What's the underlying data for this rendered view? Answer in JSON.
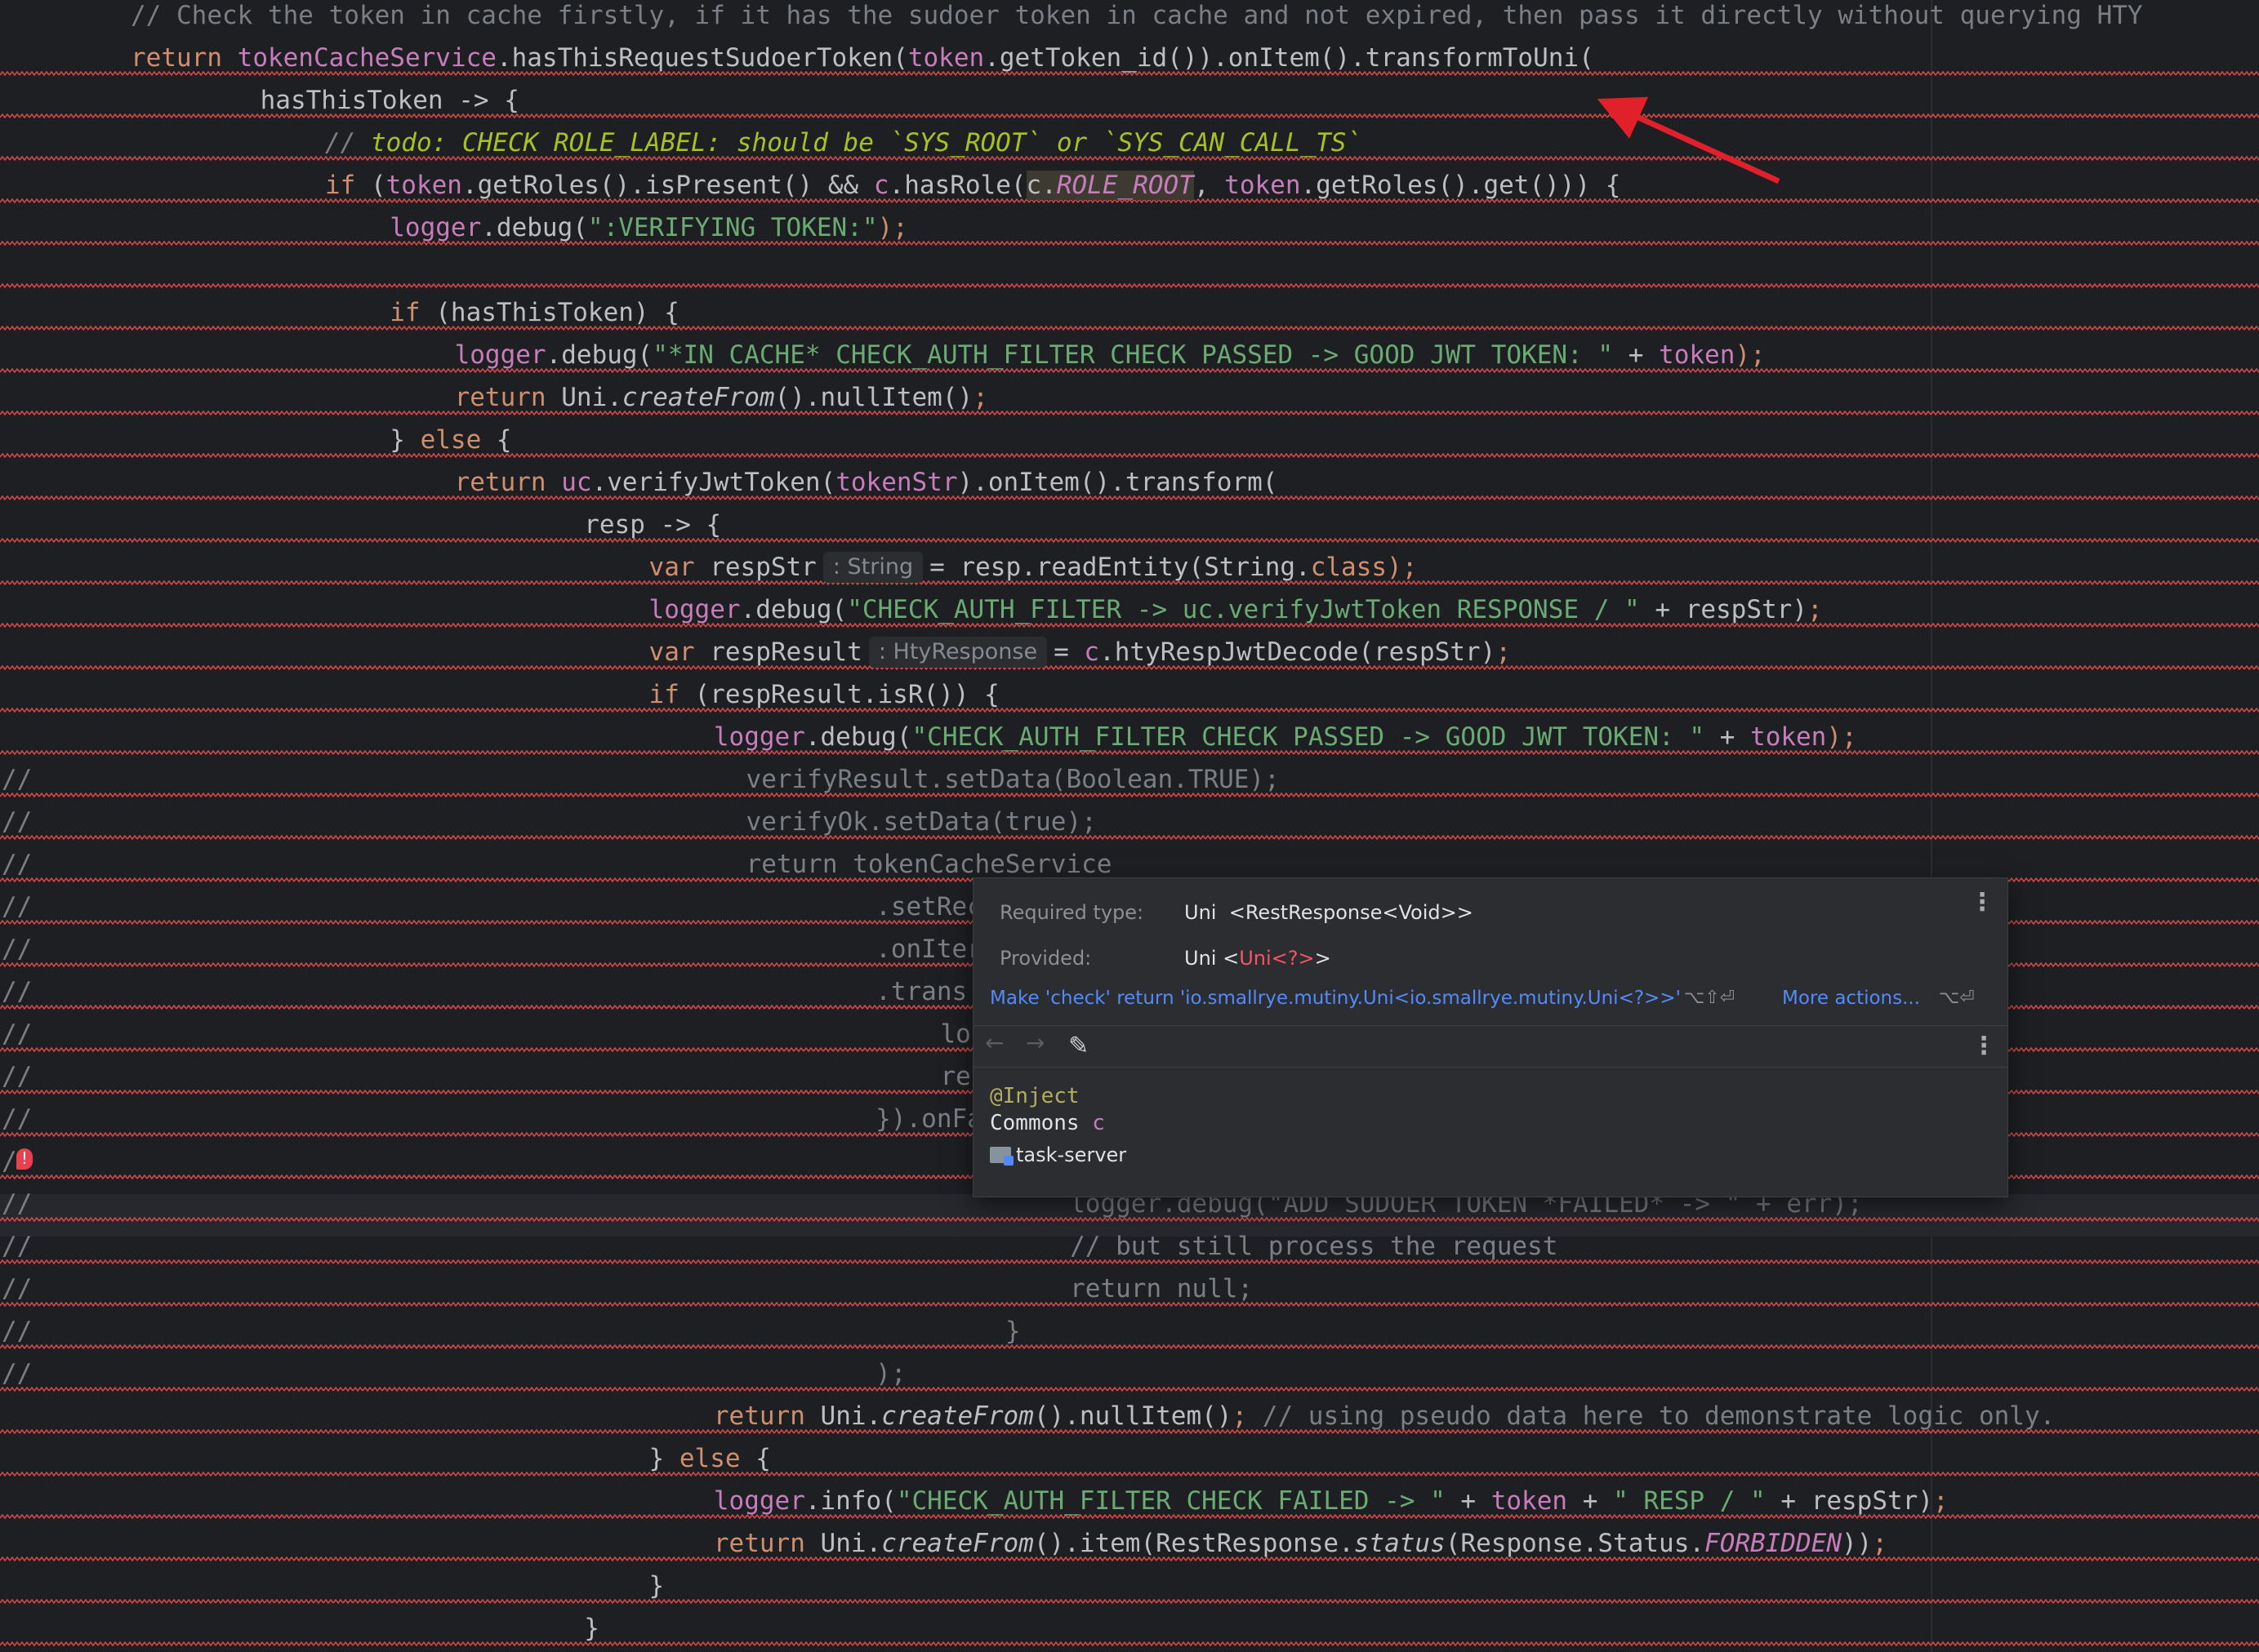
{
  "editor": {
    "lines": [
      {
        "gutter": "",
        "indent": 0,
        "tokens": [
          {
            "t": "// Check the token in cache firstly, if it has the sudoer token in cache and not expired, then pass it directly without querying HTY",
            "c": "cm"
          }
        ]
      },
      {
        "gutter": "",
        "indent": 0,
        "tokens": [
          {
            "t": "return ",
            "c": "kw"
          },
          {
            "t": "tokenCacheService",
            "c": "fld"
          },
          {
            "t": ".hasThisRequestSudoerToken(",
            "c": ""
          },
          {
            "t": "token",
            "c": "fld"
          },
          {
            "t": ".getToken_id()).onItem().transformToUni(",
            "c": ""
          }
        ]
      },
      {
        "gutter": "",
        "indent": 2,
        "tokens": [
          {
            "t": "hasThisToken -> {",
            "c": ""
          }
        ]
      },
      {
        "gutter": "",
        "indent": 3,
        "tokens": [
          {
            "t": "// ",
            "c": "cmi"
          },
          {
            "t": "todo: CHECK ROLE_LABEL: should be `SYS_ROOT` or `SYS_CAN_CALL_TS`",
            "c": "todo"
          }
        ]
      },
      {
        "gutter": "",
        "indent": 3,
        "tokens": [
          {
            "t": "if ",
            "c": "kw"
          },
          {
            "t": "(",
            "c": ""
          },
          {
            "t": "token",
            "c": "fld"
          },
          {
            "t": ".getRoles().isPresent() && ",
            "c": ""
          },
          {
            "t": "c",
            "c": "fld"
          },
          {
            "t": ".hasRole(",
            "c": ""
          },
          {
            "t": "c.",
            "c": "hl"
          },
          {
            "t": "ROLE_ROOT",
            "c": "cst hl"
          },
          {
            "t": ", ",
            "c": ""
          },
          {
            "t": "token",
            "c": "fld"
          },
          {
            "t": ".getRoles().get())) {",
            "c": ""
          }
        ]
      },
      {
        "gutter": "",
        "indent": 4,
        "tokens": [
          {
            "t": "logger",
            "c": "fld"
          },
          {
            "t": ".debug(",
            "c": ""
          },
          {
            "t": "\":VERIFYING TOKEN:\"",
            "c": "str"
          },
          {
            "t": ");",
            "c": "kw"
          }
        ]
      },
      {
        "gutter": "",
        "indent": 0,
        "tokens": []
      },
      {
        "gutter": "",
        "indent": 4,
        "tokens": [
          {
            "t": "if ",
            "c": "kw"
          },
          {
            "t": "(hasThisToken) {",
            "c": ""
          }
        ]
      },
      {
        "gutter": "",
        "indent": 5,
        "tokens": [
          {
            "t": "logger",
            "c": "fld"
          },
          {
            "t": ".debug(",
            "c": ""
          },
          {
            "t": "\"*IN CACHE* CHECK_AUTH_FILTER CHECK PASSED -> GOOD JWT TOKEN: \"",
            "c": "str"
          },
          {
            "t": " + ",
            "c": ""
          },
          {
            "t": "token",
            "c": "fld"
          },
          {
            "t": ");",
            "c": "kw"
          }
        ]
      },
      {
        "gutter": "",
        "indent": 5,
        "tokens": [
          {
            "t": "return ",
            "c": "kw"
          },
          {
            "t": "Uni.",
            "c": ""
          },
          {
            "t": "createFrom",
            "c": "it"
          },
          {
            "t": "().nullItem()",
            "c": ""
          },
          {
            "t": ";",
            "c": "kw"
          }
        ]
      },
      {
        "gutter": "",
        "indent": 4,
        "tokens": [
          {
            "t": "} ",
            "c": ""
          },
          {
            "t": "else ",
            "c": "kw"
          },
          {
            "t": "{",
            "c": ""
          }
        ]
      },
      {
        "gutter": "",
        "indent": 5,
        "tokens": [
          {
            "t": "return ",
            "c": "kw"
          },
          {
            "t": "uc",
            "c": "fld"
          },
          {
            "t": ".verifyJwtToken(",
            "c": ""
          },
          {
            "t": "tokenStr",
            "c": "fld"
          },
          {
            "t": ").onItem().transform(",
            "c": ""
          }
        ]
      },
      {
        "gutter": "",
        "indent": 7,
        "tokens": [
          {
            "t": "resp -> {",
            "c": ""
          }
        ]
      },
      {
        "gutter": "",
        "indent": 8,
        "tokens": [
          {
            "t": "var ",
            "c": "kw"
          },
          {
            "t": "respStr",
            "c": ""
          },
          {
            "t": ": String",
            "c": "hint"
          },
          {
            "t": "= resp.readEntity(String.",
            "c": ""
          },
          {
            "t": "class",
            "c": "kw"
          },
          {
            "t": ");",
            "c": "kw"
          }
        ]
      },
      {
        "gutter": "",
        "indent": 8,
        "tokens": [
          {
            "t": "logger",
            "c": "fld"
          },
          {
            "t": ".debug(",
            "c": ""
          },
          {
            "t": "\"CHECK_AUTH_FILTER -> uc.verifyJwtToken RESPONSE / \"",
            "c": "str"
          },
          {
            "t": " + respStr)",
            "c": ""
          },
          {
            "t": ";",
            "c": "kw"
          }
        ]
      },
      {
        "gutter": "",
        "indent": 8,
        "tokens": [
          {
            "t": "var ",
            "c": "kw"
          },
          {
            "t": "respResult",
            "c": ""
          },
          {
            "t": ": HtyResponse",
            "c": "hint"
          },
          {
            "t": "= ",
            "c": ""
          },
          {
            "t": "c",
            "c": "fld"
          },
          {
            "t": ".htyRespJwtDecode(respStr)",
            "c": ""
          },
          {
            "t": ";",
            "c": "kw"
          }
        ]
      },
      {
        "gutter": "",
        "indent": 8,
        "tokens": [
          {
            "t": "if ",
            "c": "kw"
          },
          {
            "t": "(respResult.isR()) {",
            "c": ""
          }
        ]
      },
      {
        "gutter": "",
        "indent": 9,
        "tokens": [
          {
            "t": "logger",
            "c": "fld"
          },
          {
            "t": ".debug(",
            "c": ""
          },
          {
            "t": "\"CHECK_AUTH_FILTER CHECK PASSED -> GOOD JWT TOKEN: \"",
            "c": "str"
          },
          {
            "t": " + ",
            "c": ""
          },
          {
            "t": "token",
            "c": "fld"
          },
          {
            "t": ");",
            "c": "kw"
          }
        ]
      },
      {
        "gutter": "//",
        "indent": 9.5,
        "tokens": [
          {
            "t": "verifyResult.setData(Boolean.TRUE);",
            "c": "cm"
          }
        ]
      },
      {
        "gutter": "//",
        "indent": 9.5,
        "tokens": [
          {
            "t": "verifyOk.setData(true);",
            "c": "cm"
          }
        ]
      },
      {
        "gutter": "//",
        "indent": 9.5,
        "tokens": [
          {
            "t": "return tokenCacheService",
            "c": "cm"
          }
        ]
      },
      {
        "gutter": "//",
        "indent": 11.5,
        "tokens": [
          {
            "t": ".setRec",
            "c": "cm"
          }
        ]
      },
      {
        "gutter": "//",
        "indent": 11.5,
        "tokens": [
          {
            "t": ".onIter",
            "c": "cm"
          }
        ]
      },
      {
        "gutter": "//",
        "indent": 11.5,
        "tokens": [
          {
            "t": ".trans",
            "c": "cm"
          }
        ]
      },
      {
        "gutter": "//",
        "indent": 12.5,
        "tokens": [
          {
            "t": "lo",
            "c": "cm"
          }
        ]
      },
      {
        "gutter": "//",
        "indent": 12.5,
        "tokens": [
          {
            "t": "ret",
            "c": "cm"
          }
        ]
      },
      {
        "gutter": "//",
        "indent": 11.5,
        "tokens": [
          {
            "t": "}).onFa",
            "c": "cm"
          }
        ]
      },
      {
        "gutter": "/",
        "indent": 0,
        "tokens": []
      },
      {
        "gutter": "//",
        "indent": 14.5,
        "tokens": [
          {
            "t": "logger.debug(\"ADD SUDOER TOKEN *FAILED* -> \" + err);",
            "c": "cm"
          }
        ]
      },
      {
        "gutter": "//",
        "indent": 14.5,
        "tokens": [
          {
            "t": "// but still process the request",
            "c": "cm"
          }
        ]
      },
      {
        "gutter": "//",
        "indent": 14.5,
        "tokens": [
          {
            "t": "return null;",
            "c": "cm"
          }
        ]
      },
      {
        "gutter": "//",
        "indent": 13.5,
        "tokens": [
          {
            "t": "}",
            "c": "cm"
          }
        ]
      },
      {
        "gutter": "//",
        "indent": 11.5,
        "tokens": [
          {
            "t": ");",
            "c": "cm"
          }
        ]
      },
      {
        "gutter": "",
        "indent": 9,
        "tokens": [
          {
            "t": "return ",
            "c": "kw"
          },
          {
            "t": "Uni.",
            "c": ""
          },
          {
            "t": "createFrom",
            "c": "it"
          },
          {
            "t": "().nullItem()",
            "c": ""
          },
          {
            "t": "; ",
            "c": "kw"
          },
          {
            "t": "// using pseudo data here to demonstrate logic only.",
            "c": "cm"
          }
        ]
      },
      {
        "gutter": "",
        "indent": 8,
        "tokens": [
          {
            "t": "} ",
            "c": ""
          },
          {
            "t": "else ",
            "c": "kw"
          },
          {
            "t": "{",
            "c": ""
          }
        ]
      },
      {
        "gutter": "",
        "indent": 9,
        "tokens": [
          {
            "t": "logger",
            "c": "fld"
          },
          {
            "t": ".info(",
            "c": ""
          },
          {
            "t": "\"CHECK_AUTH_FILTER CHECK FAILED -> \"",
            "c": "str"
          },
          {
            "t": " + ",
            "c": ""
          },
          {
            "t": "token",
            "c": "fld"
          },
          {
            "t": " + ",
            "c": ""
          },
          {
            "t": "\" RESP / \"",
            "c": "str"
          },
          {
            "t": " + respStr)",
            "c": ""
          },
          {
            "t": ";",
            "c": "kw"
          }
        ]
      },
      {
        "gutter": "",
        "indent": 9,
        "tokens": [
          {
            "t": "return ",
            "c": "kw"
          },
          {
            "t": "Uni.",
            "c": ""
          },
          {
            "t": "createFrom",
            "c": "it"
          },
          {
            "t": "().item(RestResponse.",
            "c": ""
          },
          {
            "t": "status",
            "c": "it"
          },
          {
            "t": "(Response.Status.",
            "c": ""
          },
          {
            "t": "FORBIDDEN",
            "c": "cst"
          },
          {
            "t": "))",
            "c": ""
          },
          {
            "t": ";",
            "c": "kw"
          }
        ]
      },
      {
        "gutter": "",
        "indent": 8,
        "tokens": [
          {
            "t": "}",
            "c": ""
          }
        ]
      },
      {
        "gutter": "",
        "indent": 7,
        "tokens": [
          {
            "t": "}",
            "c": ""
          }
        ]
      }
    ]
  },
  "popup": {
    "required_label": "Required type:",
    "required_type": "Uni",
    "required_generic": "<RestResponse<Void>>",
    "provided_label": "Provided:",
    "provided_type": "Uni",
    "provided_generic_open": "<",
    "provided_generic_red": "Uni<?>",
    "provided_generic_close": ">",
    "fix_action": "Make 'check' return 'io.smallrye.mutiny.Uni<io.smallrye.mutiny.Uni<?>>'",
    "fix_shortcut": "⌥⇧⏎",
    "more_actions": "More actions...",
    "more_shortcut": "⌥⏎",
    "back_icon": "←",
    "forward_icon": "→",
    "edit_icon": "✎",
    "menu_icon": "⋮",
    "doc_annotation": "@Inject",
    "doc_type": "Commons",
    "doc_param": "c",
    "doc_module": "task-server"
  },
  "gutter_error_icon": "!",
  "colors": {
    "background": "#1e1f22",
    "keyword": "#cf8e6d",
    "string": "#6aab73",
    "field": "#c77dbb",
    "comment": "#7a7e85",
    "todo": "#a8c023",
    "error_squiggle": "#d14747",
    "arrow": "#e0202a",
    "link": "#548af7"
  }
}
